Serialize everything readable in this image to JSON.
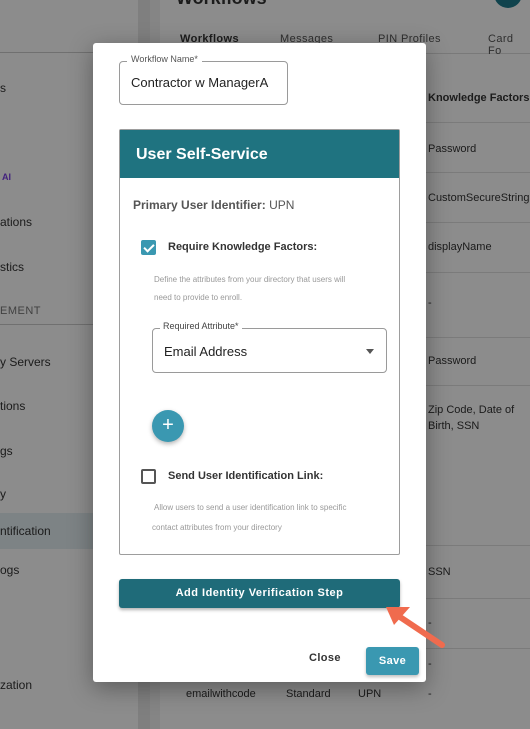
{
  "background": {
    "header_title": "Workflows",
    "tabs": [
      {
        "label": "Workflows"
      },
      {
        "label": "Messages"
      },
      {
        "label": "PIN Profiles"
      },
      {
        "label": "Card Fo"
      }
    ],
    "sidebar_items": [
      {
        "label": "s"
      },
      {
        "label": "ations"
      },
      {
        "label": "stics"
      },
      {
        "label": "y Servers"
      },
      {
        "label": "tions"
      },
      {
        "label": "gs"
      },
      {
        "label": "y"
      },
      {
        "label": "ntification"
      },
      {
        "label": "ogs"
      },
      {
        "label": "zation"
      }
    ],
    "sidebar_ai_badge": "AI",
    "sidebar_section": "EMENT",
    "table_header": "Knowledge Factors",
    "table_cells": [
      {
        "value": "Password"
      },
      {
        "value": "CustomSecureString"
      },
      {
        "value": "displayName"
      },
      {
        "value": "-"
      },
      {
        "value": "Password"
      },
      {
        "value": "Zip Code, Date of"
      },
      {
        "value": "Birth, SSN"
      },
      {
        "value": "SSN"
      },
      {
        "value": "-"
      },
      {
        "value": "-"
      }
    ],
    "last_row": {
      "name": "emailwithcode",
      "type": "Standard",
      "id": "UPN",
      "factors": "-"
    }
  },
  "dialog": {
    "workflow_name_label": "Workflow Name*",
    "workflow_name_value": "Contractor w ManagerA",
    "panel_title": "User Self-Service",
    "primary_identifier_label": "Primary User Identifier:",
    "primary_identifier_value": "UPN",
    "require_kf_label": "Require Knowledge Factors:",
    "require_kf_checked": true,
    "require_kf_help_1": "Define the attributes from your directory that users will",
    "require_kf_help_2": "need to provide to enroll.",
    "required_attribute_label": "Required Attribute*",
    "required_attribute_value": "Email Address",
    "add_icon": "plus-icon",
    "send_link_label": "Send User Identification Link:",
    "send_link_checked": false,
    "send_link_help_1": "Allow users to send a user identification link to specific",
    "send_link_help_2": "contact attributes from your directory",
    "add_verification_label": "Add Identity Verification Step",
    "close_label": "Close",
    "save_label": "Save"
  },
  "colors": {
    "panel_header": "#1f7380",
    "accent": "#3a98b1",
    "verify_button": "#1f6b79",
    "arrow": "#f06b4e"
  }
}
